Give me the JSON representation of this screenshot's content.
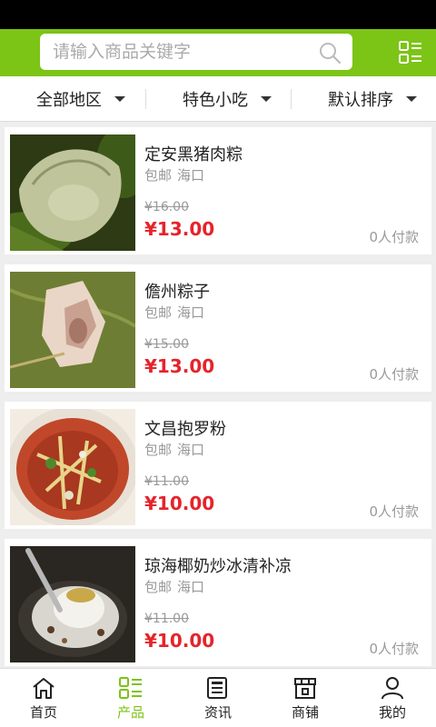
{
  "search": {
    "placeholder": "请输入商品关键字"
  },
  "filters": [
    {
      "label": "全部地区"
    },
    {
      "label": "特色小吃"
    },
    {
      "label": "默认排序"
    }
  ],
  "products": [
    {
      "name": "定安黑猪肉粽",
      "shipping": "包邮",
      "location": "海口",
      "original_price": "¥16.00",
      "price": "¥13.00",
      "paid": "0人付款"
    },
    {
      "name": "儋州粽子",
      "shipping": "包邮",
      "location": "海口",
      "original_price": "¥15.00",
      "price": "¥13.00",
      "paid": "0人付款"
    },
    {
      "name": "文昌抱罗粉",
      "shipping": "包邮",
      "location": "海口",
      "original_price": "¥11.00",
      "price": "¥10.00",
      "paid": "0人付款"
    },
    {
      "name": "琼海椰奶炒冰清补凉",
      "shipping": "包邮",
      "location": "海口",
      "original_price": "¥11.00",
      "price": "¥10.00",
      "paid": "0人付款"
    }
  ],
  "tabs": [
    {
      "label": "首页",
      "icon": "home-icon"
    },
    {
      "label": "产品",
      "icon": "products-icon",
      "active": true
    },
    {
      "label": "资讯",
      "icon": "news-icon"
    },
    {
      "label": "商铺",
      "icon": "store-icon"
    },
    {
      "label": "我的",
      "icon": "user-icon"
    }
  ],
  "colors": {
    "brand": "#7cc416",
    "price": "#e5242b",
    "muted": "#999999"
  }
}
